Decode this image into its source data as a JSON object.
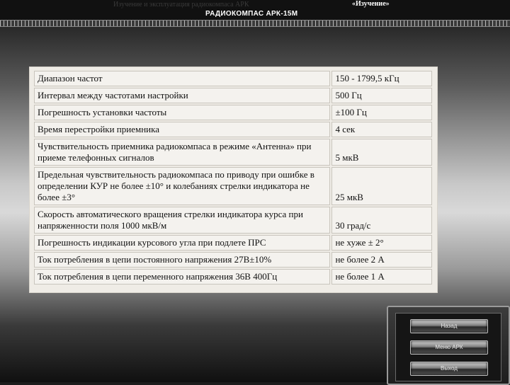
{
  "header": {
    "faint_title": "Изучение и эксплуатация радиокомпаса АРК",
    "mode": "«Изучение»",
    "device": "РАДИОКОМПАС АРК-15М"
  },
  "specs": {
    "rows": [
      {
        "param": "Диапазон частот",
        "value": "150 - 1799,5 кГц"
      },
      {
        "param": "Интервал между частотами настройки",
        "value": "500 Гц"
      },
      {
        "param": "Погрешность установки частоты",
        "value": "±100 Гц"
      },
      {
        "param": "Время перестройки приемника",
        "value": "4 сек"
      },
      {
        "param": "Чувствительность приемника радиокомпаса в режиме «Антенна» при приеме телефонных сигналов",
        "value": "5 мкВ"
      },
      {
        "param": "Предельная чувствительность радиокомпаса по приводу при ошибке в определении КУР не более ±10° и колебаниях стрелки индикатора не более ±3°",
        "value": "25 мкВ"
      },
      {
        "param": "Скорость автоматического вращения стрелки индикатора курса при напряженности поля 1000 мкВ/м",
        "value": "30 град/с"
      },
      {
        "param": "Погрешность индикации курсового угла при подлете ПРС",
        "value": "не хуже ± 2°"
      },
      {
        "param": "Ток потребления в цепи постоянного напряжения 27В±10%",
        "value": "не более 2 А"
      },
      {
        "param": "Ток потребления в цепи переменного напряжения 36В 400Гц",
        "value": "не более 1 А"
      }
    ]
  },
  "menu": {
    "items": [
      "Назад",
      "Меню АРК",
      "Выход"
    ]
  }
}
